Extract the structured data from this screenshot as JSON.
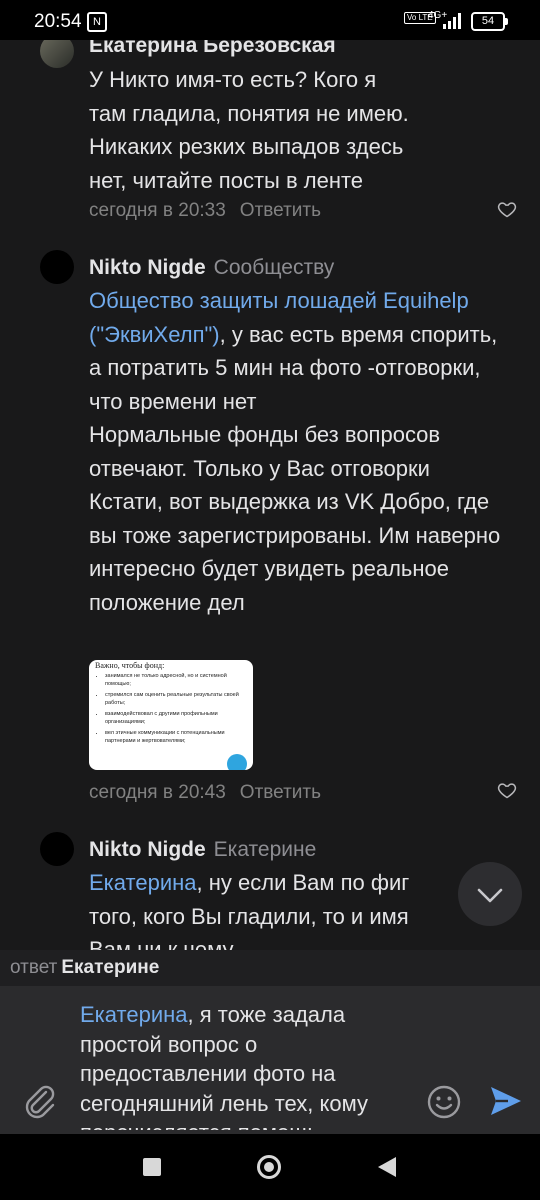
{
  "status_bar": {
    "time": "20:54",
    "network": "4G+",
    "volte": "Vo LTE",
    "battery": "54"
  },
  "comments": [
    {
      "author": "Екатерина Березовская",
      "text_lines": [
        "У Никто имя-то есть? Кого я",
        "там гладила, понятия не имею.",
        "Никаких резких выпадов здесь",
        "нет, читайте посты в ленте"
      ],
      "time": "сегодня в 20:33",
      "reply_label": "Ответить"
    },
    {
      "author": "Nikto Nigde",
      "reply_to": "Сообществу",
      "mention": "Общество защиты лошадей Equihelp (\"ЭквиХелп\")",
      "text_after_mention": ", у вас есть время спорить, а потратить 5 мин на фото -отговорки, что времени нет",
      "paragraph_2": "Нормальные фонды без вопросов отвечают. Только у Вас отговорки",
      "paragraph_3": "Кстати, вот выдержка из VK Добро, где вы тоже зарегистрированы. Им наверно интересно будет увидеть реальное положение дел",
      "attachment": {
        "title": "Важно, чтобы фонд:",
        "items": [
          "занимался не только адресной, но и системной помощью;",
          "стремился сам оценить реальные результаты своей работы;",
          "взаимодействовал с другими профильными организациями;",
          "вел этичные коммуникации с потенциальными партнерами и жертвователями;"
        ]
      },
      "time": "сегодня в 20:43",
      "reply_label": "Ответить"
    },
    {
      "author": "Nikto Nigde",
      "reply_to": "Екатерине",
      "mention": "Екатерина",
      "text_after_mention": ", ну если Вам по фиг",
      "line_2": "того, кого Вы гладили, то и имя",
      "line_3": "Вам ни к чему"
    }
  ],
  "reply_bar": {
    "prefix": "ответ",
    "target": "Екатерине"
  },
  "composer": {
    "mention": "Екатерина",
    "text": ", я тоже задала простой вопрос о предоставлении фото на сегодняшний лень тех, кому перечисляется помощь"
  },
  "icons": {
    "like": "heart-outline-icon",
    "scroll_down": "chevron-down-icon",
    "attach": "paperclip-icon",
    "emoji": "smiley-icon",
    "send": "send-arrow-icon"
  },
  "colors": {
    "background": "#19191a",
    "link": "#71aaeb",
    "send": "#5f9eea",
    "muted": "#828282"
  }
}
